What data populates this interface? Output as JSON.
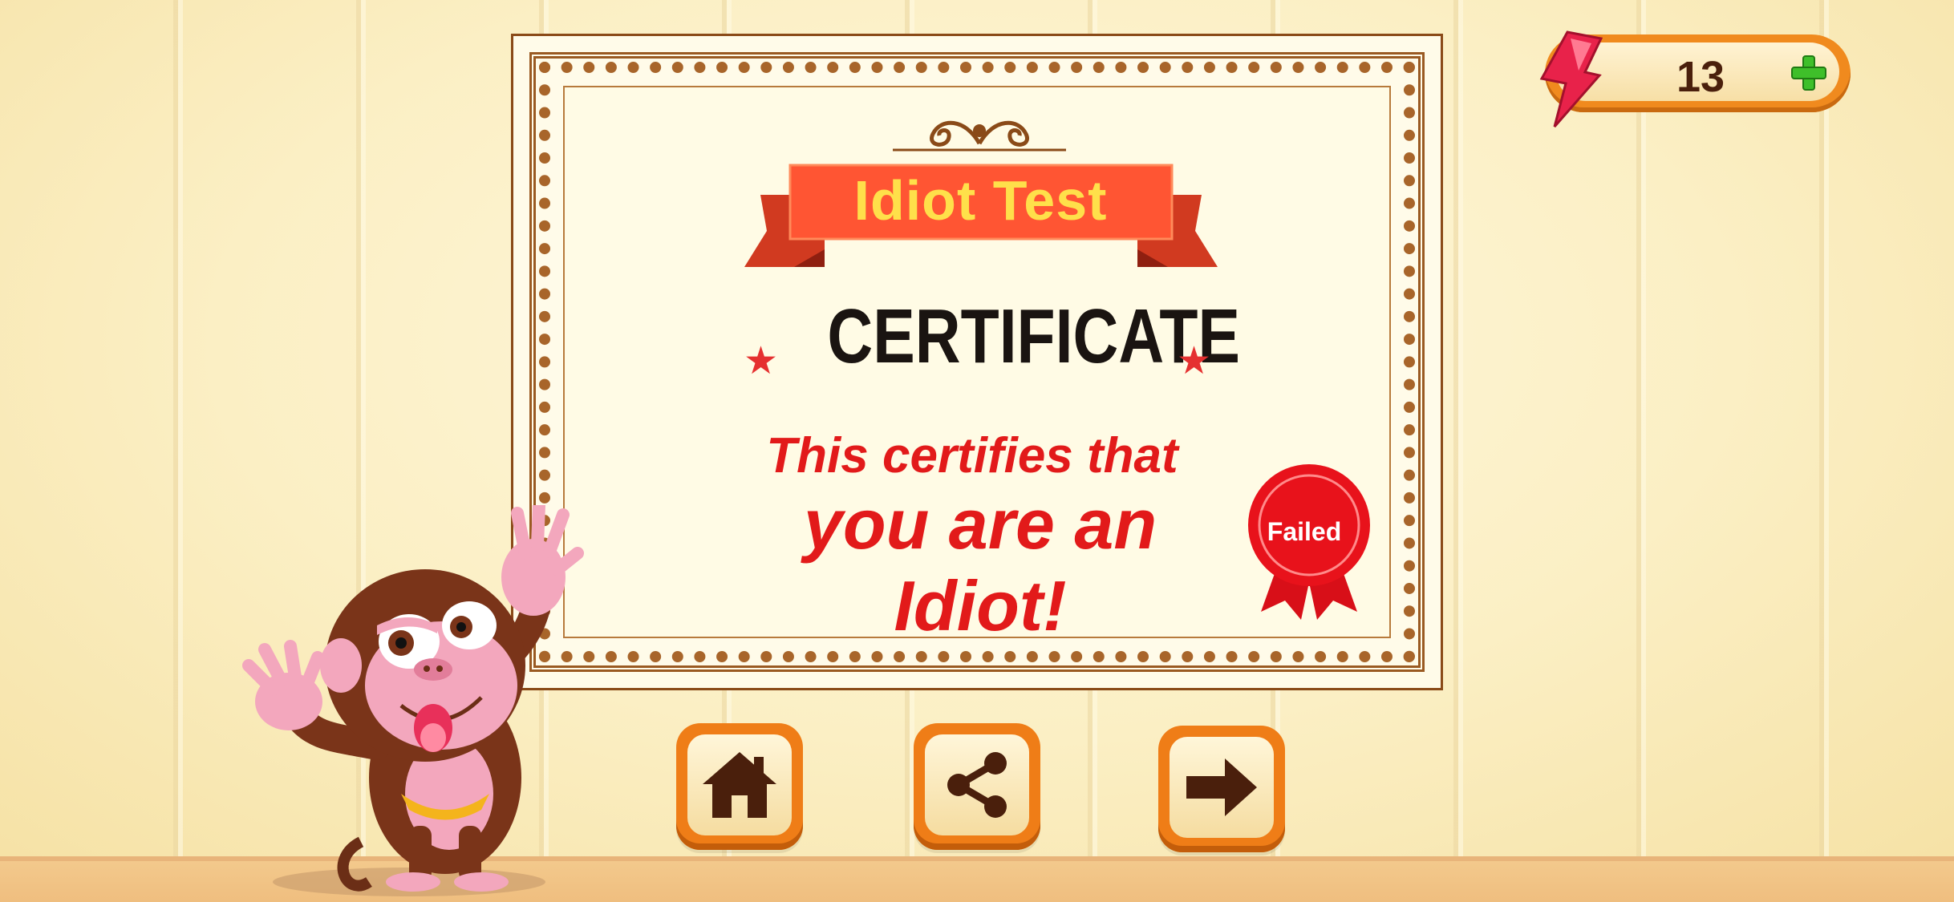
{
  "certificate": {
    "ribbon_title": "Idiot Test",
    "heading": "CERTIFICATE",
    "line1": "This certifies that",
    "line2": "you are an Idiot!",
    "seal_label": "Failed"
  },
  "hud": {
    "energy_value": "13",
    "energy_icon": "lightning-bolt-icon",
    "add_icon": "plus-icon"
  },
  "buttons": {
    "home_icon": "home-icon",
    "share_icon": "share-icon",
    "next_icon": "arrow-right-icon"
  },
  "colors": {
    "ribbon": "#ff5533",
    "ribbon_text": "#ffe04a",
    "statement_text": "#e21a1a",
    "seal": "#e8121b",
    "button_frame": "#ef7d17",
    "icon": "#4a1f0c",
    "plus": "#3fbf2a"
  }
}
